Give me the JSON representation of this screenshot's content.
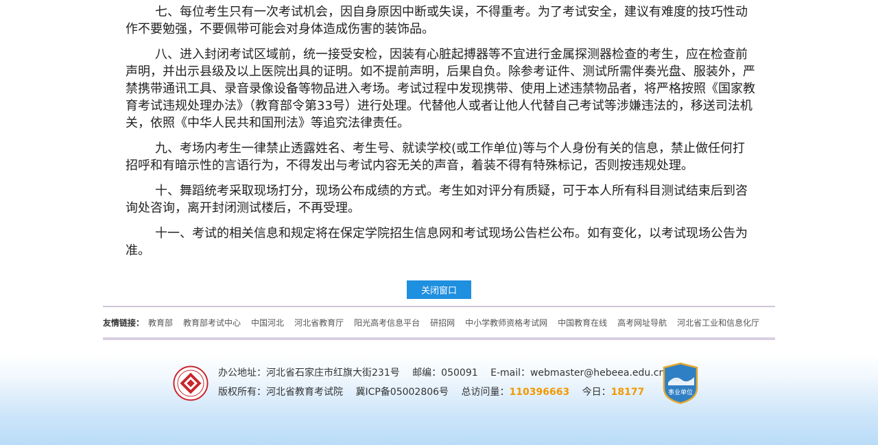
{
  "paragraphs": [
    "七、每位考生只有一次考试机会，因自身原因中断或失误，不得重考。为了考试安全，建议有难度的技巧性动作不要勉强，不要佩带可能会对身体造成伤害的装饰品。",
    "八、进入封闭考试区域前，统一接受安检，因装有心脏起搏器等不宜进行金属探测器检查的考生，应在检查前声明，并出示县级及以上医院出具的证明。如不提前声明，后果自负。除参考证件、测试所需伴奏光盘、服装外，严禁携带通讯工具、录音录像设备等物品进入考场。考试过程中发现携带、使用上述违禁物品者，将严格按照《国家教育考试违规处理办法》（教育部令第33号）进行处理。代替他人或者让他人代替自己考试等涉嫌违法的，移送司法机关，依照《中华人民共和国刑法》等追究法律责任。",
    "九、考场内考生一律禁止透露姓名、考生号、就读学校(或工作单位)等与个人身份有关的信息，禁止做任何打招呼和有暗示性的言语行为，不得发出与考试内容无关的声音，着装不得有特殊标记，否则按违规处理。",
    "十、舞蹈统考采取现场打分，现场公布成绩的方式。考生如对评分有质疑，可于本人所有科目测试结束后到咨询处咨询，离开封闭测试楼后，不再受理。",
    "十一、考试的相关信息和规定将在保定学院招生信息网和考试现场公告栏公布。如有变化，以考试现场公告为准。"
  ],
  "close_button": "关闭窗口",
  "links": {
    "label": "友情链接：",
    "items": [
      "教育部",
      "教育部考试中心",
      "中国河北",
      "河北省教育厅",
      "阳光高考信息平台",
      "研招网",
      "中小学教师资格考试网",
      "中国教育在线",
      "高考网址导航",
      "河北省工业和信息化厅"
    ]
  },
  "footer": {
    "address": "办公地址：河北省石家庄市红旗大街231号",
    "postcode": "邮编：050091",
    "email": "E-mail：webmaster@hebeea.edu.cn",
    "copyright": "版权所有：河北省教育考试院",
    "icp": "冀ICP备05002806号",
    "visits_label": "总访问量：",
    "visits_value": "110396663",
    "today_label": "今日：",
    "today_value": "18177",
    "badge_text": "事业单位"
  },
  "colors": {
    "button": "#1f8fe0",
    "highlight": "#f39800",
    "logo_red": "#c9252c",
    "badge_blue": "#2f7fc4"
  }
}
